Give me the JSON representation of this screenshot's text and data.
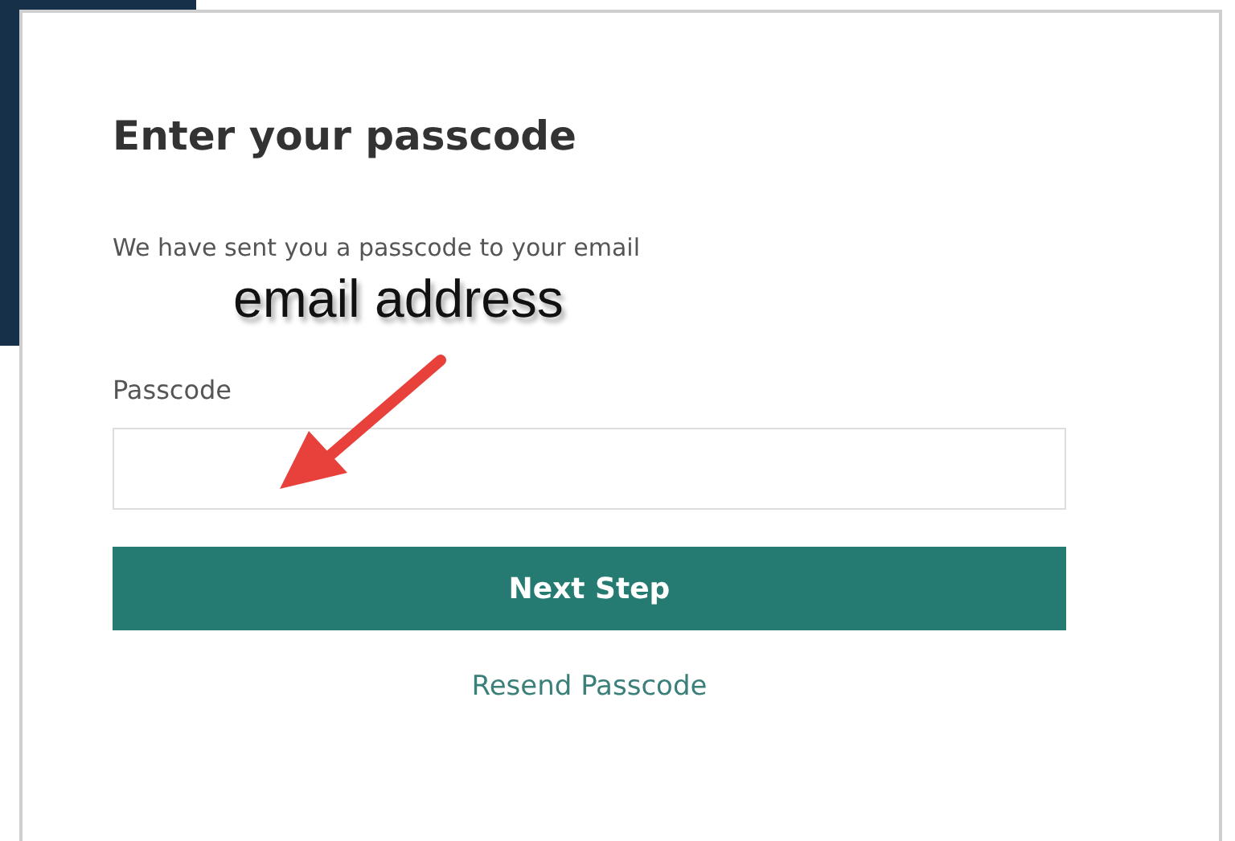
{
  "form": {
    "title": "Enter your passcode",
    "message": "We have sent you a passcode to your email",
    "field_label": "Passcode",
    "button": "Next Step",
    "link": "Resend Passcode"
  },
  "annotation": {
    "text": "email address"
  }
}
